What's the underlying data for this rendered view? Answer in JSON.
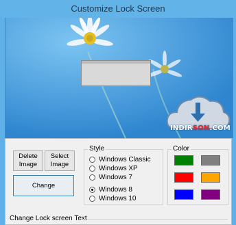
{
  "window": {
    "title": "Customize Lock Screen"
  },
  "watermark": {
    "brand_main": "INDIR",
    "brand_accent": "SON",
    "brand_tail": ".COM"
  },
  "buttons": {
    "delete_image": "Delete Image",
    "select_image": "Select Image",
    "change": "Change"
  },
  "style_group": {
    "label": "Style",
    "options": [
      {
        "label": "Windows Classic",
        "checked": false
      },
      {
        "label": "Windows XP",
        "checked": false
      },
      {
        "label": "Windows 7",
        "checked": false
      },
      {
        "label": "Windows 8",
        "checked": true
      },
      {
        "label": "Windows 10",
        "checked": false
      }
    ]
  },
  "color_group": {
    "label": "Color",
    "swatches": [
      {
        "name": "green",
        "color": "#008000"
      },
      {
        "name": "gray",
        "color": "#808080"
      },
      {
        "name": "red",
        "color": "#ff0000"
      },
      {
        "name": "orange",
        "color": "#ffa500"
      },
      {
        "name": "blue",
        "color": "#0000ff"
      },
      {
        "name": "purple",
        "color": "#800080"
      }
    ]
  },
  "footer": {
    "label": "Change Lock screen Text"
  }
}
